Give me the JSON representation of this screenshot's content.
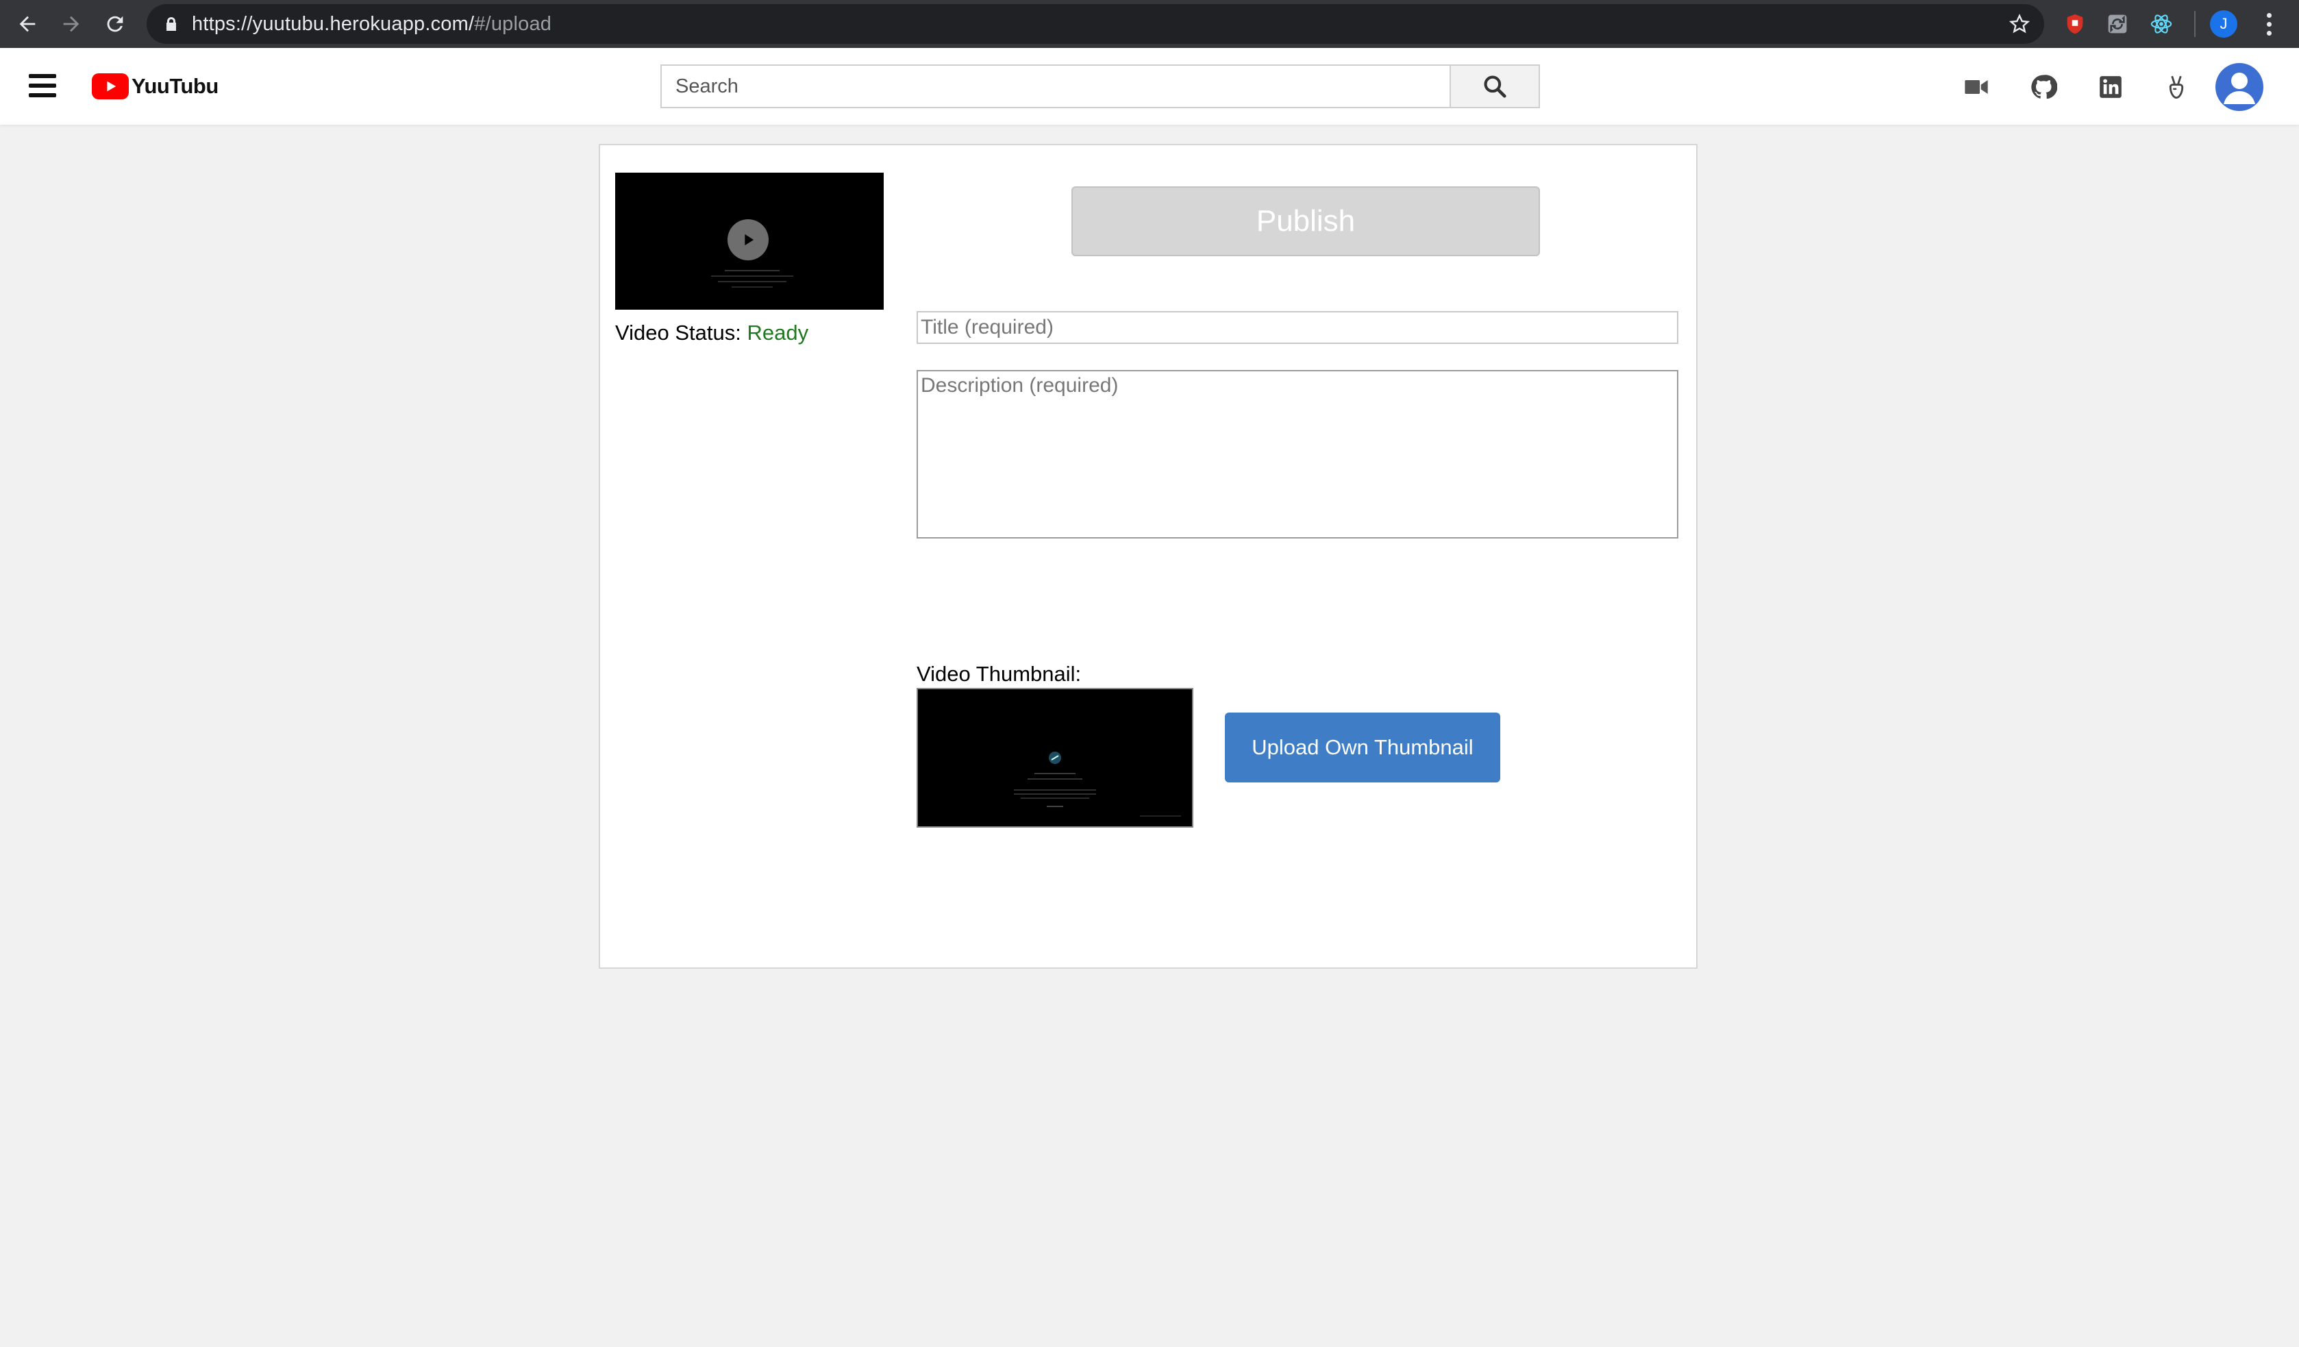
{
  "browser": {
    "url_main": "https://yuutubu.herokuapp.com/",
    "url_rest": "#/upload",
    "profile_initial": "J"
  },
  "header": {
    "brand": "YuuTubu",
    "search_placeholder": "Search",
    "icons": [
      "video-camera-icon",
      "github-icon",
      "linkedin-icon",
      "angellist-icon",
      "user-avatar-icon"
    ]
  },
  "upload": {
    "publish_label": "Publish",
    "status_label": "Video Status:",
    "status_value": "Ready",
    "title_placeholder": "Title (required)",
    "description_placeholder": "Description (required)",
    "thumbnail_label": "Video Thumbnail:",
    "upload_thumbnail_label": "Upload Own Thumbnail"
  },
  "colors": {
    "brand_red": "#ff0000",
    "status_ready": "#1f7a1f",
    "upload_button": "#3f7ec6",
    "publish_disabled": "#d6d6d6"
  }
}
